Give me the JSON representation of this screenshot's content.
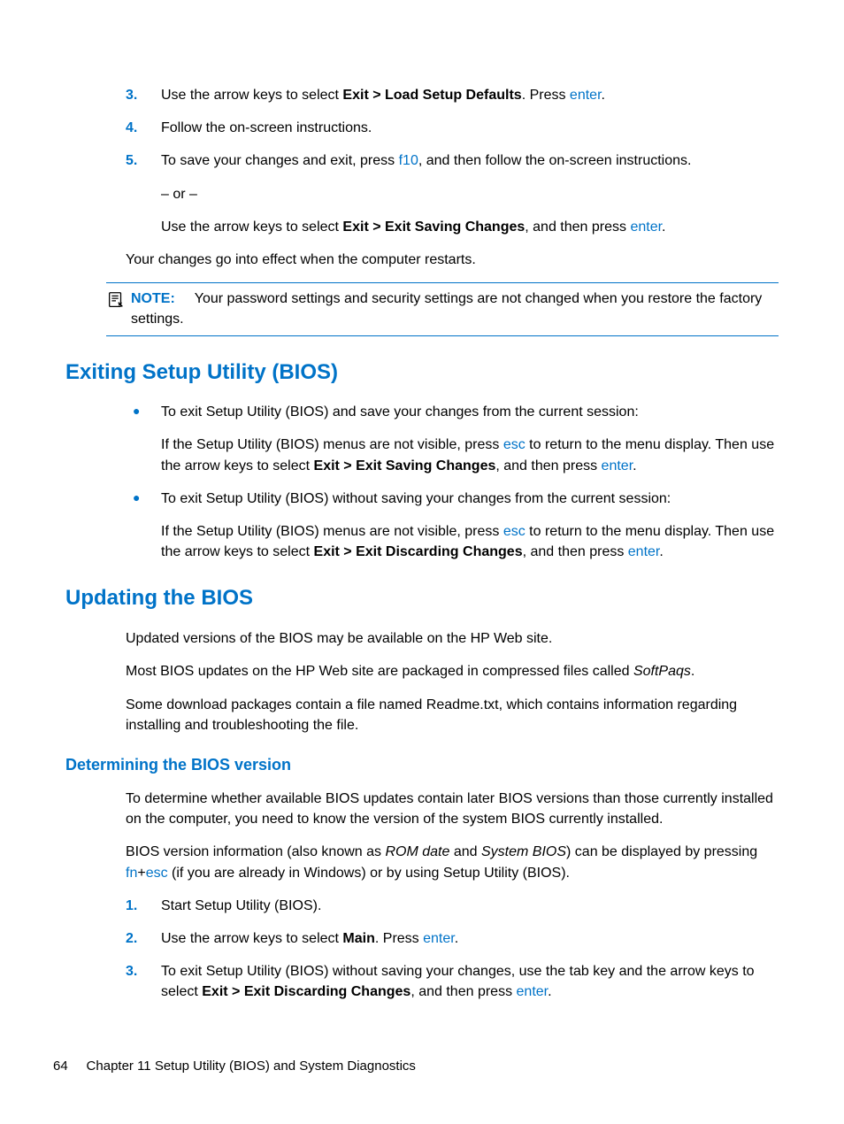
{
  "steps_top": {
    "s3": {
      "num": "3.",
      "t1": "Use the arrow keys to select ",
      "b1": "Exit > Load Setup Defaults",
      "t2": ". Press ",
      "k1": "enter",
      "t3": "."
    },
    "s4": {
      "num": "4.",
      "t1": "Follow the on-screen instructions."
    },
    "s5": {
      "num": "5.",
      "t1": "To save your changes and exit, press ",
      "k1": "f10",
      "t2": ", and then follow the on-screen instructions.",
      "or": "– or –",
      "t3": "Use the arrow keys to select ",
      "b1": "Exit > Exit Saving Changes",
      "t4": ", and then press ",
      "k2": "enter",
      "t5": "."
    }
  },
  "after_steps": "Your changes go into effect when the computer restarts.",
  "note": {
    "label": "NOTE:",
    "body": "Your password settings and security settings are not changed when you restore the factory settings."
  },
  "h2_exit": "Exiting Setup Utility (BIOS)",
  "exit_b1": {
    "lead": "To exit Setup Utility (BIOS) and save your changes from the current session:",
    "t1": "If the Setup Utility (BIOS) menus are not visible, press ",
    "k1": "esc",
    "t2": " to return to the menu display. Then use the arrow keys to select ",
    "b1": "Exit > Exit Saving Changes",
    "t3": ", and then press ",
    "k2": "enter",
    "t4": "."
  },
  "exit_b2": {
    "lead": "To exit Setup Utility (BIOS) without saving your changes from the current session:",
    "t1": "If the Setup Utility (BIOS) menus are not visible, press ",
    "k1": "esc",
    "t2": " to return to the menu display. Then use the arrow keys to select ",
    "b1": "Exit > Exit Discarding Changes",
    "t3": ", and then press ",
    "k2": "enter",
    "t4": "."
  },
  "h2_update": "Updating the BIOS",
  "update_p1": "Updated versions of the BIOS may be available on the HP Web site.",
  "update_p2a": "Most BIOS updates on the HP Web site are packaged in compressed files called ",
  "update_p2b": "SoftPaqs",
  "update_p2c": ".",
  "update_p3": "Some download packages contain a file named Readme.txt, which contains information regarding installing and troubleshooting the file.",
  "h3_det": "Determining the BIOS version",
  "det_p1": "To determine whether available BIOS updates contain later BIOS versions than those currently installed on the computer, you need to know the version of the system BIOS currently installed.",
  "det_p2": {
    "t1": "BIOS version information (also known as ",
    "i1": "ROM date",
    "t2": " and ",
    "i2": "System BIOS",
    "t3": ") can be displayed by pressing ",
    "k1": "fn",
    "plus": "+",
    "k2": "esc",
    "t4": " (if you are already in Windows) or by using Setup Utility (BIOS)."
  },
  "det_steps": {
    "s1": {
      "num": "1.",
      "t": "Start Setup Utility (BIOS)."
    },
    "s2": {
      "num": "2.",
      "t1": "Use the arrow keys to select ",
      "b1": "Main",
      "t2": ". Press ",
      "k1": "enter",
      "t3": "."
    },
    "s3": {
      "num": "3.",
      "t1": "To exit Setup Utility (BIOS) without saving your changes, use the tab key and the arrow keys to select ",
      "b1": "Exit > Exit Discarding Changes",
      "t2": ", and then press ",
      "k1": "enter",
      "t3": "."
    }
  },
  "footer": {
    "page": "64",
    "chap": "Chapter 11   Setup Utility (BIOS) and System Diagnostics"
  }
}
